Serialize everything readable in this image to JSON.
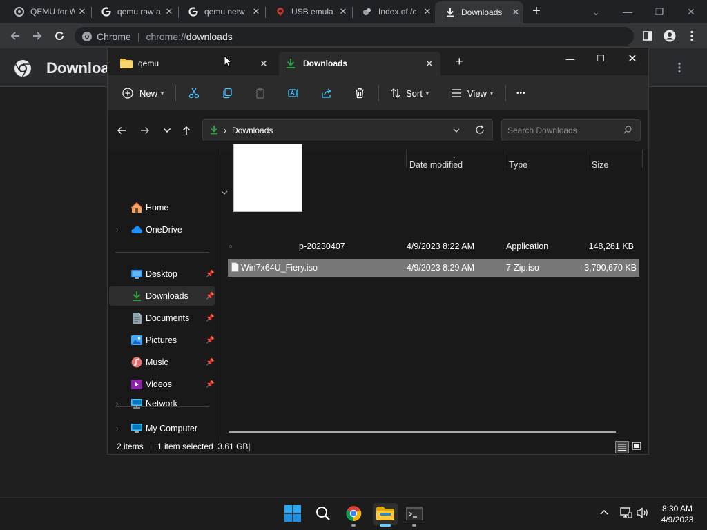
{
  "chrome": {
    "tabs": [
      {
        "title": "QEMU for W",
        "favicon": "qemu-icon"
      },
      {
        "title": "qemu raw a",
        "favicon": "google-icon"
      },
      {
        "title": "qemu netw",
        "favicon": "google-icon"
      },
      {
        "title": "USB emula",
        "favicon": "site-icon"
      },
      {
        "title": "Index of /c",
        "favicon": "site-icon"
      },
      {
        "title": "Downloads",
        "favicon": "download-icon",
        "active": true
      }
    ],
    "omnibox": {
      "origin": "Chrome",
      "scheme": "chrome://",
      "path": "downloads"
    },
    "page_title": "Downloa"
  },
  "explorer": {
    "tabs": [
      {
        "label": "qemu",
        "icon": "folder-icon"
      },
      {
        "label": "Downloads",
        "icon": "download-icon",
        "active": true
      }
    ],
    "commands": {
      "new": "New",
      "sort": "Sort",
      "view": "View",
      "more": "•••"
    },
    "address": {
      "location": "Downloads"
    },
    "search": {
      "placeholder": "Search Downloads"
    },
    "sidebar": {
      "quick": [
        {
          "label": "Home",
          "icon": "home-icon"
        },
        {
          "label": "OneDrive",
          "icon": "cloud-icon",
          "expandable": true
        }
      ],
      "pinned": [
        {
          "label": "Desktop",
          "icon": "desktop-icon",
          "pinned": true
        },
        {
          "label": "Downloads",
          "icon": "download-icon",
          "pinned": true,
          "selected": true
        },
        {
          "label": "Documents",
          "icon": "document-icon",
          "pinned": true
        },
        {
          "label": "Pictures",
          "icon": "picture-icon",
          "pinned": true
        },
        {
          "label": "Music",
          "icon": "music-icon",
          "pinned": true
        },
        {
          "label": "Videos",
          "icon": "video-icon",
          "pinned": true
        }
      ],
      "devices": [
        {
          "label": "My Computer",
          "icon": "computer-icon",
          "expandable": true
        },
        {
          "label": "Network",
          "icon": "network-icon",
          "expandable": true
        }
      ]
    },
    "columns": {
      "date": "Date modified",
      "type": "Type",
      "size": "Size"
    },
    "files": [
      {
        "name": "p-20230407",
        "date": "4/9/2023 8:22 AM",
        "type": "Application",
        "size": "148,281 KB",
        "selected": false
      },
      {
        "name": "Win7x64U_Fiery.iso",
        "date": "4/9/2023 8:29 AM",
        "type": "7-Zip.iso",
        "size": "3,790,670 KB",
        "selected": true
      }
    ],
    "status": {
      "items": "2 items",
      "selected": "1 item selected  3.61 GB"
    }
  },
  "taskbar": {
    "time": "8:30 AM",
    "date": "4/9/2023"
  },
  "colors": {
    "accent": "#60cdff",
    "download_green": "#2ea043",
    "folder_yellow": "#f4c542"
  }
}
